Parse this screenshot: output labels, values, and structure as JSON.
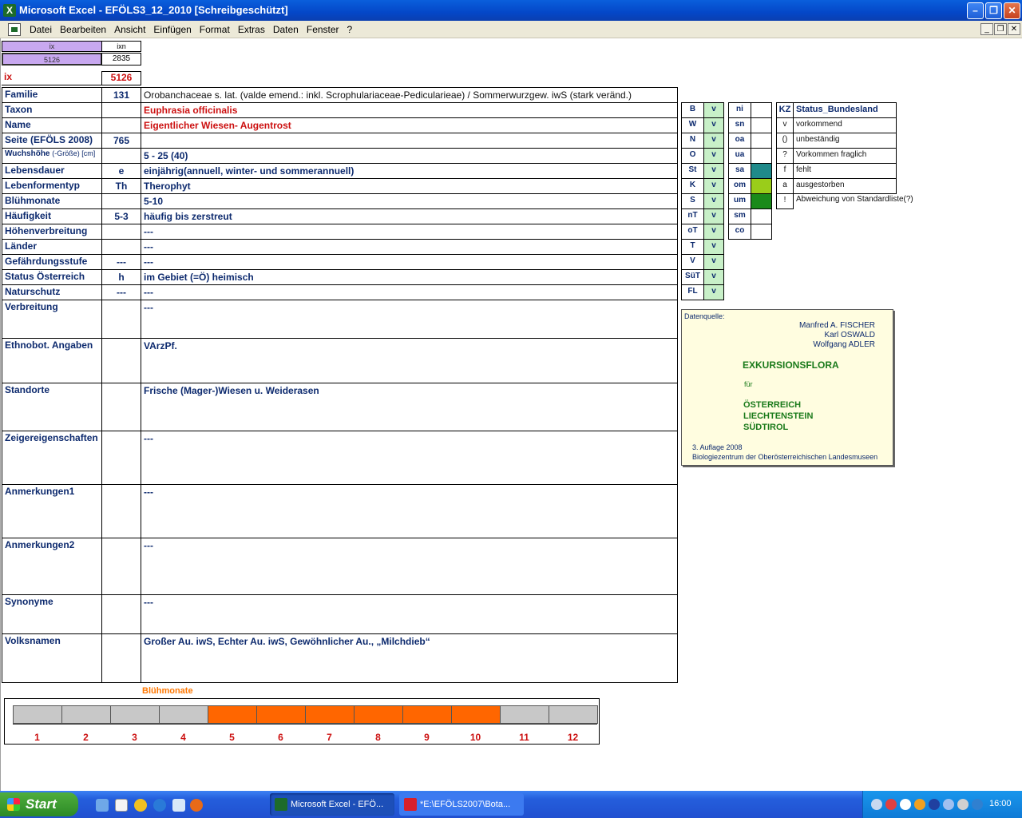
{
  "window": {
    "title": "Microsoft Excel - EFÖLS3_12_2010  [Schreibgeschützt]"
  },
  "menu": [
    "Datei",
    "Bearbeiten",
    "Ansicht",
    "Einfügen",
    "Format",
    "Extras",
    "Daten",
    "Fenster",
    "?"
  ],
  "index": {
    "col1_header": "ix",
    "col2_header": "ixn",
    "col1_value": "5126",
    "col2_value": "2835",
    "label": "ix",
    "value": "5126"
  },
  "rows": [
    {
      "label": "Familie",
      "code": "131",
      "value": "Orobanchaceae s. lat. (valde emend.: inkl. Scrophulariaceae-Pedicularieae)  /  Sommerwurzgew. iwS (stark veränd.)",
      "style": "plain"
    },
    {
      "label": "Taxon",
      "code": "",
      "value": "Euphrasia officinalis",
      "style": "redbold"
    },
    {
      "label": "Name",
      "code": "",
      "value": "Eigentlicher Wiesen- Augentrost",
      "style": "red"
    },
    {
      "label": "Seite (EFÖLS 2008)",
      "code": "765",
      "value": "",
      "style": "bold"
    },
    {
      "label": "Wuchshöhe",
      "label_suffix": "(-Größe) [cm]",
      "code": "",
      "value": " 5 - 25 (40)",
      "style": "bold"
    },
    {
      "label": "Lebensdauer",
      "code": "e",
      "value": "einjährig(annuell, winter- und sommerannuell)",
      "style": "bold"
    },
    {
      "label": "Lebenformentyp",
      "code": "Th",
      "value": "Therophyt",
      "style": "bold"
    },
    {
      "label": "Blühmonate",
      "code": "",
      "value": " 5-10",
      "style": "bold"
    },
    {
      "label": "Häufigkeit",
      "code": "5-3",
      "value": "häufig bis zerstreut",
      "style": "bold"
    },
    {
      "label": "Höhenverbreitung",
      "code": "",
      "value": " ---",
      "style": "bold"
    },
    {
      "label": "Länder",
      "code": "",
      "value": " ---",
      "style": "bold"
    },
    {
      "label": "Gefährdungsstufe",
      "code": "---",
      "value": "  ---",
      "style": "bold"
    },
    {
      "label": "Status Österreich",
      "code": "h",
      "value": "im Gebiet (=Ö) heimisch",
      "style": "bold"
    },
    {
      "label": "Naturschutz",
      "code": "---",
      "value": " ---",
      "style": "bold"
    },
    {
      "label": "Verbreitung",
      "code": "",
      "value": " ---",
      "style": "bold"
    },
    {
      "label": "Ethnobot. Angaben",
      "code": "",
      "value": "VArzPf.",
      "style": "bold"
    },
    {
      "label": "Standorte",
      "code": "",
      "value": "Frische (Mager-)Wiesen u. Weiderasen",
      "style": "bold"
    },
    {
      "label": "Zeigereigenschaften",
      "code": "",
      "value": "---",
      "style": "bold"
    },
    {
      "label": "Anmerkungen1",
      "code": "",
      "value": "---",
      "style": "bold"
    },
    {
      "label": "Anmerkungen2",
      "code": "",
      "value": "---",
      "style": "bold"
    },
    {
      "label": "Synonyme",
      "code": "",
      "value": "---",
      "style": "bold"
    },
    {
      "label": "Volksnamen",
      "code": "",
      "value": "Großer Au. iwS,  Echter Au. iwS, Gewöhnlicher Au., „Milchdieb“",
      "style": "bold"
    }
  ],
  "status_grid": {
    "col_a": [
      "B",
      "W",
      "N",
      "O",
      "St",
      "K",
      "S",
      "nT",
      "oT",
      "T",
      "V",
      "SüT",
      "FL"
    ],
    "col_a_vals": [
      "v",
      "v",
      "v",
      "v",
      "v",
      "v",
      "v",
      "v",
      "v",
      "v",
      "v",
      "v",
      "v"
    ],
    "col_b": [
      "ni",
      "sn",
      "oa",
      "ua",
      "sa",
      "om",
      "um",
      "sm",
      "co"
    ],
    "col_b_colors": [
      "",
      "",
      "",
      "",
      "#1f8a8a",
      "#9acd1a",
      "#1a8a1a",
      "",
      ""
    ]
  },
  "legend": {
    "header_code": "KZ",
    "header_text": "Status_Bundesland",
    "items": [
      {
        "code": "v",
        "text": "vorkommend"
      },
      {
        "code": "()",
        "text": "unbeständig"
      },
      {
        "code": "?",
        "text": "Vorkommen fraglich"
      },
      {
        "code": "f",
        "text": "fehlt"
      },
      {
        "code": "a",
        "text": "ausgestorben"
      },
      {
        "code": "!",
        "text": "Abweichung von Standardliste(?)"
      }
    ]
  },
  "source": {
    "label": "Datenquelle:",
    "authors": [
      "Manfred A. FISCHER",
      "Karl OSWALD",
      "Wolfgang ADLER"
    ],
    "title": "EXKURSIONSFLORA",
    "for": "für",
    "countries": [
      "ÖSTERREICH",
      "LIECHTENSTEIN",
      "SÜDTIROL"
    ],
    "edition": "3. Auflage 2008",
    "publisher": "Biologiezentrum der Oberösterreichischen Landesmuseen"
  },
  "bloom": {
    "title": "Blühmonate",
    "months": [
      "1",
      "2",
      "3",
      "4",
      "5",
      "6",
      "7",
      "8",
      "9",
      "10",
      "11",
      "12"
    ],
    "active": [
      false,
      false,
      false,
      false,
      true,
      true,
      true,
      true,
      true,
      true,
      false,
      false
    ],
    "active_color": "#ff6600",
    "inactive_color": "#c8c8c8"
  },
  "taskbar": {
    "start": "Start",
    "tasks": [
      "Microsoft Excel - EFÖ...",
      "*E:\\EFÖLS2007\\Bota..."
    ],
    "clock": "16:00"
  }
}
